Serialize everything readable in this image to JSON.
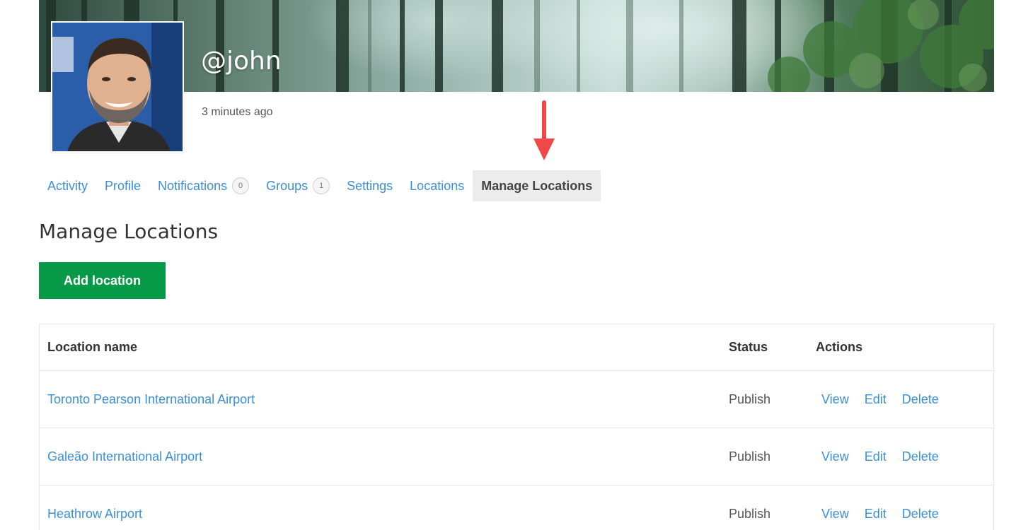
{
  "profile": {
    "username": "@john",
    "last_active": "3 minutes ago"
  },
  "nav": {
    "items": [
      {
        "label": "Activity"
      },
      {
        "label": "Profile"
      },
      {
        "label": "Notifications",
        "count": "0"
      },
      {
        "label": "Groups",
        "count": "1"
      },
      {
        "label": "Settings"
      },
      {
        "label": "Locations"
      },
      {
        "label": "Manage Locations",
        "active": true
      }
    ]
  },
  "page": {
    "title": "Manage Locations",
    "add_button": "Add location"
  },
  "table": {
    "headers": {
      "name": "Location name",
      "status": "Status",
      "actions": "Actions"
    },
    "rows": [
      {
        "name": "Toronto Pearson International Airport",
        "status": "Publish",
        "view": "View",
        "edit": "Edit",
        "delete": "Delete"
      },
      {
        "name": "Galeão International Airport",
        "status": "Publish",
        "view": "View",
        "edit": "Edit",
        "delete": "Delete"
      },
      {
        "name": "Heathrow Airport",
        "status": "Publish",
        "view": "View",
        "edit": "Edit",
        "delete": "Delete"
      }
    ]
  },
  "colors": {
    "link": "#3c8fd6",
    "primary_button": "#069a48",
    "annotation_arrow": "#f04848"
  }
}
